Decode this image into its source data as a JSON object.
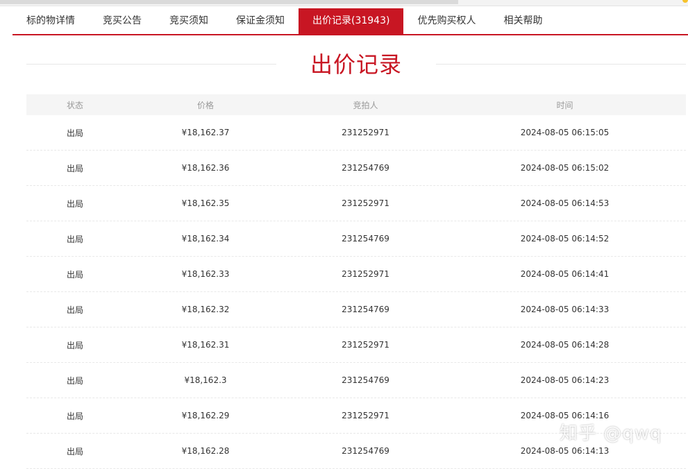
{
  "tabs": [
    {
      "label": "标的物详情",
      "active": false
    },
    {
      "label": "竞买公告",
      "active": false
    },
    {
      "label": "竞买须知",
      "active": false
    },
    {
      "label": "保证金须知",
      "active": false
    },
    {
      "label": "出价记录(31943)",
      "active": true
    },
    {
      "label": "优先购买权人",
      "active": false
    },
    {
      "label": "相关帮助",
      "active": false
    }
  ],
  "section_title": "出价记录",
  "table": {
    "headers": [
      "状态",
      "价格",
      "竞拍人",
      "时间"
    ],
    "rows": [
      {
        "status": "出局",
        "price": "¥18,162.37",
        "bidder": "231252971",
        "time": "2024-08-05 06:15:05"
      },
      {
        "status": "出局",
        "price": "¥18,162.36",
        "bidder": "231254769",
        "time": "2024-08-05 06:15:02"
      },
      {
        "status": "出局",
        "price": "¥18,162.35",
        "bidder": "231252971",
        "time": "2024-08-05 06:14:53"
      },
      {
        "status": "出局",
        "price": "¥18,162.34",
        "bidder": "231254769",
        "time": "2024-08-05 06:14:52"
      },
      {
        "status": "出局",
        "price": "¥18,162.33",
        "bidder": "231252971",
        "time": "2024-08-05 06:14:41"
      },
      {
        "status": "出局",
        "price": "¥18,162.32",
        "bidder": "231254769",
        "time": "2024-08-05 06:14:33"
      },
      {
        "status": "出局",
        "price": "¥18,162.31",
        "bidder": "231252971",
        "time": "2024-08-05 06:14:28"
      },
      {
        "status": "出局",
        "price": "¥18,162.3",
        "bidder": "231254769",
        "time": "2024-08-05 06:14:23"
      },
      {
        "status": "出局",
        "price": "¥18,162.29",
        "bidder": "231252971",
        "time": "2024-08-05 06:14:16"
      },
      {
        "status": "出局",
        "price": "¥18,162.28",
        "bidder": "231254769",
        "time": "2024-08-05 06:14:13"
      }
    ]
  },
  "watermark": "知乎 @qwq",
  "colors": {
    "accent": "#c81623",
    "header_bg": "#f5f5f5"
  }
}
